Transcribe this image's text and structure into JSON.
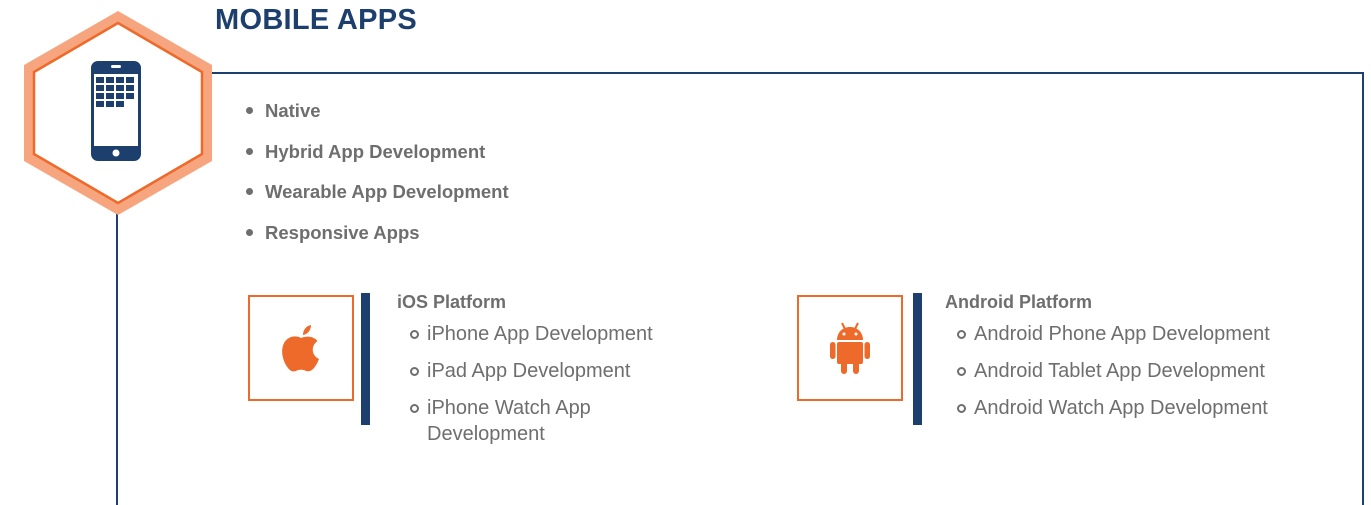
{
  "section": {
    "title": "MOBILE APPS",
    "icon": "mobile-phone-icon"
  },
  "features": [
    {
      "label": "Native"
    },
    {
      "label": "Hybrid App Development"
    },
    {
      "label": "Wearable App Development"
    },
    {
      "label": "Responsive Apps"
    }
  ],
  "ios": {
    "icon": "apple-icon",
    "title": "iOS Platform",
    "items": [
      {
        "label": "iPhone App Development"
      },
      {
        "label": "iPad App Development"
      },
      {
        "label": "iPhone Watch App Development"
      }
    ]
  },
  "android": {
    "icon": "android-icon",
    "title": "Android Platform",
    "items": [
      {
        "label": "Android Phone App Development"
      },
      {
        "label": "Android Tablet App Development"
      },
      {
        "label": "Android Watch App Development"
      }
    ]
  },
  "colors": {
    "navy": "#1c3f6e",
    "orange": "#ee6a2a",
    "hex_fill": "#f7a57f",
    "text_gray": "#6e6e6e"
  }
}
